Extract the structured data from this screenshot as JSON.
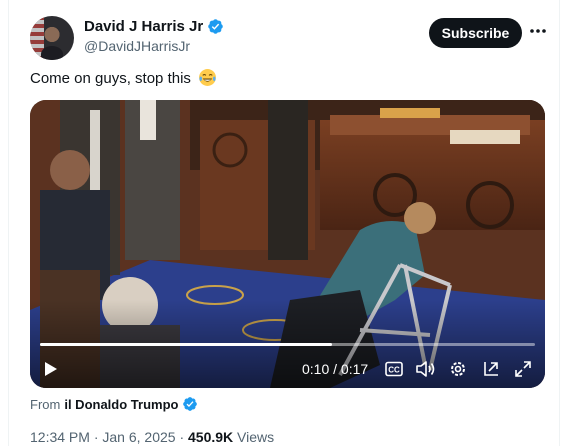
{
  "author": {
    "display_name": "David J Harris Jr",
    "handle": "@DavidJHarrisJr",
    "verified_icon": "verified-badge-icon"
  },
  "header": {
    "subscribe_label": "Subscribe",
    "more_icon": "more-horizontal-icon"
  },
  "tweet": {
    "text": "Come on guys, stop this",
    "emoji": "tears-of-joy-emoji"
  },
  "video": {
    "current_time": "0:10",
    "separator": " / ",
    "duration": "0:17",
    "progress_fraction": 0.59,
    "icons": [
      "play-icon",
      "captions-icon",
      "volume-icon",
      "settings-icon",
      "pop-out-icon",
      "fullscreen-icon"
    ]
  },
  "attribution": {
    "prefix": "From",
    "source_name": "il Donaldo Trumpo"
  },
  "meta": {
    "time": "12:34 PM",
    "dot1": " · ",
    "date": "Jan 6, 2025",
    "dot2": " · ",
    "views_count": "450.9K",
    "views_label": " Views"
  },
  "colors": {
    "verified_blue": "#1d9bf0",
    "text_primary": "#0f1419",
    "text_secondary": "#536471"
  }
}
